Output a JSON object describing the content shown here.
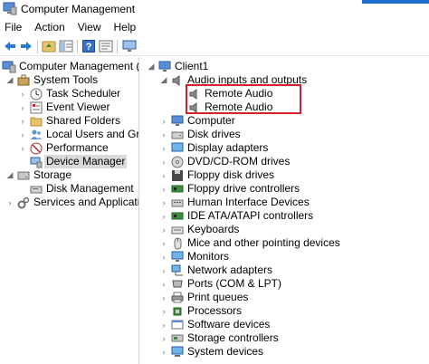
{
  "window": {
    "title": "Computer Management"
  },
  "menu": [
    "File",
    "Action",
    "View",
    "Help"
  ],
  "left_tree": {
    "root": "Computer Management (Local",
    "system_tools": "System Tools",
    "items": [
      "Task Scheduler",
      "Event Viewer",
      "Shared Folders",
      "Local Users and Groups",
      "Performance",
      "Device Manager"
    ],
    "storage": "Storage",
    "disk_management": "Disk Management",
    "services": "Services and Applications"
  },
  "right_tree": {
    "root": "Client1",
    "audio_group": "Audio inputs and outputs",
    "audio_children": [
      "Remote Audio",
      "Remote Audio"
    ],
    "categories": [
      "Computer",
      "Disk drives",
      "Display adapters",
      "DVD/CD-ROM drives",
      "Floppy disk drives",
      "Floppy drive controllers",
      "Human Interface Devices",
      "IDE ATA/ATAPI controllers",
      "Keyboards",
      "Mice and other pointing devices",
      "Monitors",
      "Network adapters",
      "Ports (COM & LPT)",
      "Print queues",
      "Processors",
      "Software devices",
      "Storage controllers",
      "System devices"
    ]
  },
  "colors": {
    "highlight": "#d6202c",
    "selection": "#d9d9d9",
    "accent": "#1f6fd1"
  }
}
